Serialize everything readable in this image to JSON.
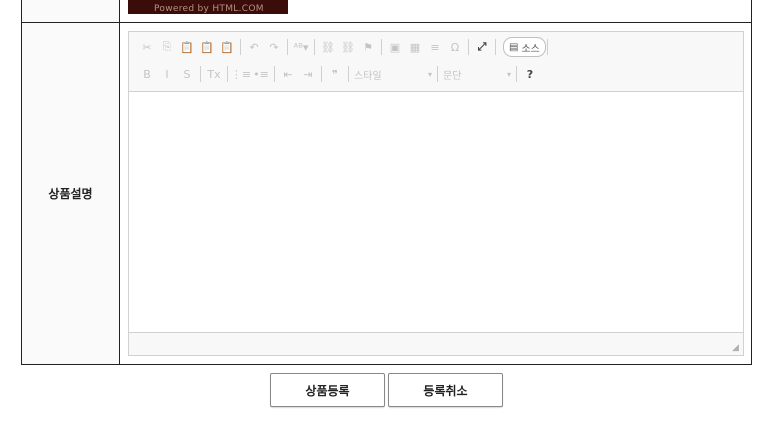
{
  "banner": {
    "text": "Powered by HTML.COM"
  },
  "form": {
    "description_label": "상품설명"
  },
  "editor": {
    "toolbar_row1": [
      {
        "icon": "cut-icon",
        "glyph": "✂"
      },
      {
        "icon": "copy-icon",
        "glyph": "⎘"
      },
      {
        "icon": "paste-icon",
        "glyph": "📋"
      },
      {
        "icon": "paste-text-icon",
        "glyph": "📋"
      },
      {
        "icon": "paste-word-icon",
        "glyph": "📋"
      },
      {
        "sep": true
      },
      {
        "icon": "undo-icon",
        "glyph": "↶"
      },
      {
        "icon": "redo-icon",
        "glyph": "↷"
      },
      {
        "sep": true
      },
      {
        "icon": "spellcheck-icon",
        "glyph": "ᴬᴮ▾"
      },
      {
        "sep": true
      },
      {
        "icon": "link-icon",
        "glyph": "⛓"
      },
      {
        "icon": "unlink-icon",
        "glyph": "⛓"
      },
      {
        "icon": "anchor-icon",
        "glyph": "⚑"
      },
      {
        "sep": true
      },
      {
        "icon": "image-icon",
        "glyph": "▣"
      },
      {
        "icon": "table-icon",
        "glyph": "▦"
      },
      {
        "icon": "horizontal-rule-icon",
        "glyph": "≡"
      },
      {
        "icon": "special-char-icon",
        "glyph": "Ω"
      },
      {
        "sep": true
      },
      {
        "icon": "maximize-icon",
        "glyph": "⤢",
        "dark": true
      },
      {
        "sep": true
      }
    ],
    "source_button": {
      "label": "소스"
    },
    "toolbar_row2": [
      {
        "icon": "bold-icon",
        "glyph": "B"
      },
      {
        "icon": "italic-icon",
        "glyph": "I"
      },
      {
        "icon": "strike-icon",
        "glyph": "S"
      },
      {
        "sep": true
      },
      {
        "icon": "remove-format-icon",
        "glyph": "Tx"
      },
      {
        "sep": true
      },
      {
        "icon": "numbered-list-icon",
        "glyph": "⋮≡"
      },
      {
        "icon": "bulleted-list-icon",
        "glyph": "•≡"
      },
      {
        "sep": true
      },
      {
        "icon": "outdent-icon",
        "glyph": "⇤"
      },
      {
        "icon": "indent-icon",
        "glyph": "⇥"
      },
      {
        "sep": true
      },
      {
        "icon": "blockquote-icon",
        "glyph": "❞"
      },
      {
        "sep": true
      }
    ],
    "style_combo": "스타일",
    "format_combo": "문단",
    "help_glyph": "?"
  },
  "buttons": {
    "submit": "상품등록",
    "cancel": "등록취소"
  }
}
